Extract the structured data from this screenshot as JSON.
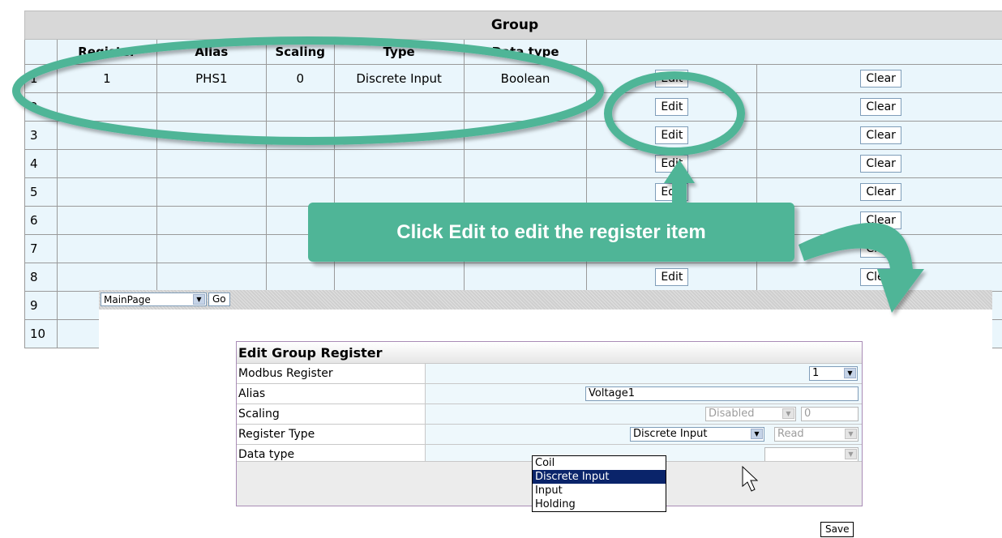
{
  "group_table": {
    "title": "Group",
    "columns": [
      "Register",
      "Alias",
      "Scaling",
      "Type",
      "Data type"
    ],
    "rows": [
      {
        "n": "1",
        "register": "1",
        "alias": "PHS1",
        "scaling": "0",
        "type": "Discrete Input",
        "data_type": "Boolean"
      },
      {
        "n": "2",
        "register": "",
        "alias": "",
        "scaling": "",
        "type": "",
        "data_type": ""
      },
      {
        "n": "3",
        "register": "",
        "alias": "",
        "scaling": "",
        "type": "",
        "data_type": ""
      },
      {
        "n": "4",
        "register": "",
        "alias": "",
        "scaling": "",
        "type": "",
        "data_type": ""
      },
      {
        "n": "5",
        "register": "",
        "alias": "",
        "scaling": "",
        "type": "",
        "data_type": ""
      },
      {
        "n": "6",
        "register": "",
        "alias": "",
        "scaling": "",
        "type": "",
        "data_type": ""
      },
      {
        "n": "7",
        "register": "",
        "alias": "",
        "scaling": "",
        "type": "",
        "data_type": ""
      },
      {
        "n": "8",
        "register": "",
        "alias": "",
        "scaling": "",
        "type": "",
        "data_type": ""
      },
      {
        "n": "9",
        "register": "",
        "alias": "",
        "scaling": "",
        "type": "",
        "data_type": ""
      },
      {
        "n": "10",
        "register": "",
        "alias": "",
        "scaling": "",
        "type": "",
        "data_type": ""
      }
    ],
    "edit_label": "Edit",
    "clear_label": "Clear"
  },
  "nav": {
    "page_select": "MainPage",
    "go_label": "Go"
  },
  "edit_form": {
    "title": "Edit Group Register",
    "modbus_register_label": "Modbus Register",
    "modbus_register_value": "1",
    "alias_label": "Alias",
    "alias_value": "Voltage1",
    "scaling_label": "Scaling",
    "scaling_select": "Disabled",
    "scaling_value": "0",
    "register_type_label": "Register Type",
    "register_type_value": "Discrete Input",
    "access_value": "Read",
    "data_type_label": "Data type",
    "register_type_options": [
      "Coil",
      "Discrete Input",
      "Input",
      "Holding"
    ],
    "save_label": "Save"
  },
  "annotation": {
    "text": "Click Edit to edit the register item"
  },
  "colors": {
    "annotation_green": "#4fb597",
    "table_cell_bg": "#eaf6fc",
    "highlight_option": "#0a246a"
  }
}
